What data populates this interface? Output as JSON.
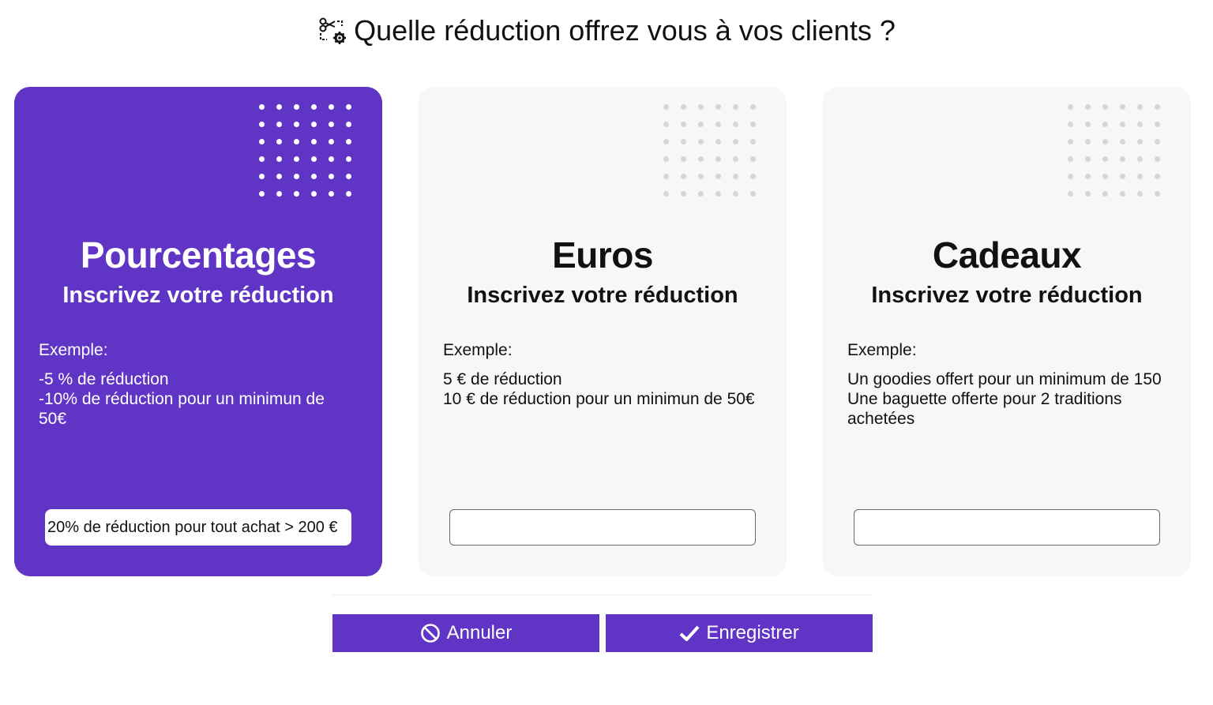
{
  "header": {
    "title": "Quelle réduction offrez vous à vos clients ?",
    "icon": "scissors-cog-icon"
  },
  "cards": [
    {
      "title": "Pourcentages",
      "subtitle": "Inscrivez votre réduction",
      "example_label": "Exemple:",
      "example_lines": [
        "-5 % de réduction",
        "-10% de réduction pour un minimun de 50€"
      ],
      "input_value": "20% de réduction pour tout achat > 200 €",
      "selected": true
    },
    {
      "title": "Euros",
      "subtitle": "Inscrivez votre réduction",
      "example_label": "Exemple:",
      "example_lines": [
        "5 € de réduction",
        "10 € de réduction pour un minimun de 50€"
      ],
      "input_value": "",
      "selected": false
    },
    {
      "title": "Cadeaux",
      "subtitle": "Inscrivez votre réduction",
      "example_label": "Exemple:",
      "example_lines": [
        "Un goodies offert pour un minimum de 150",
        "Une baguette offerte pour 2 traditions achetées"
      ],
      "input_value": "",
      "selected": false
    }
  ],
  "actions": {
    "cancel_label": "Annuler",
    "cancel_icon": "ban-icon",
    "save_label": "Enregistrer",
    "save_icon": "check-icon"
  },
  "colors": {
    "accent": "#6035c6",
    "card_bg": "#f6f7f9",
    "dot_gray": "#d6d6d9"
  }
}
